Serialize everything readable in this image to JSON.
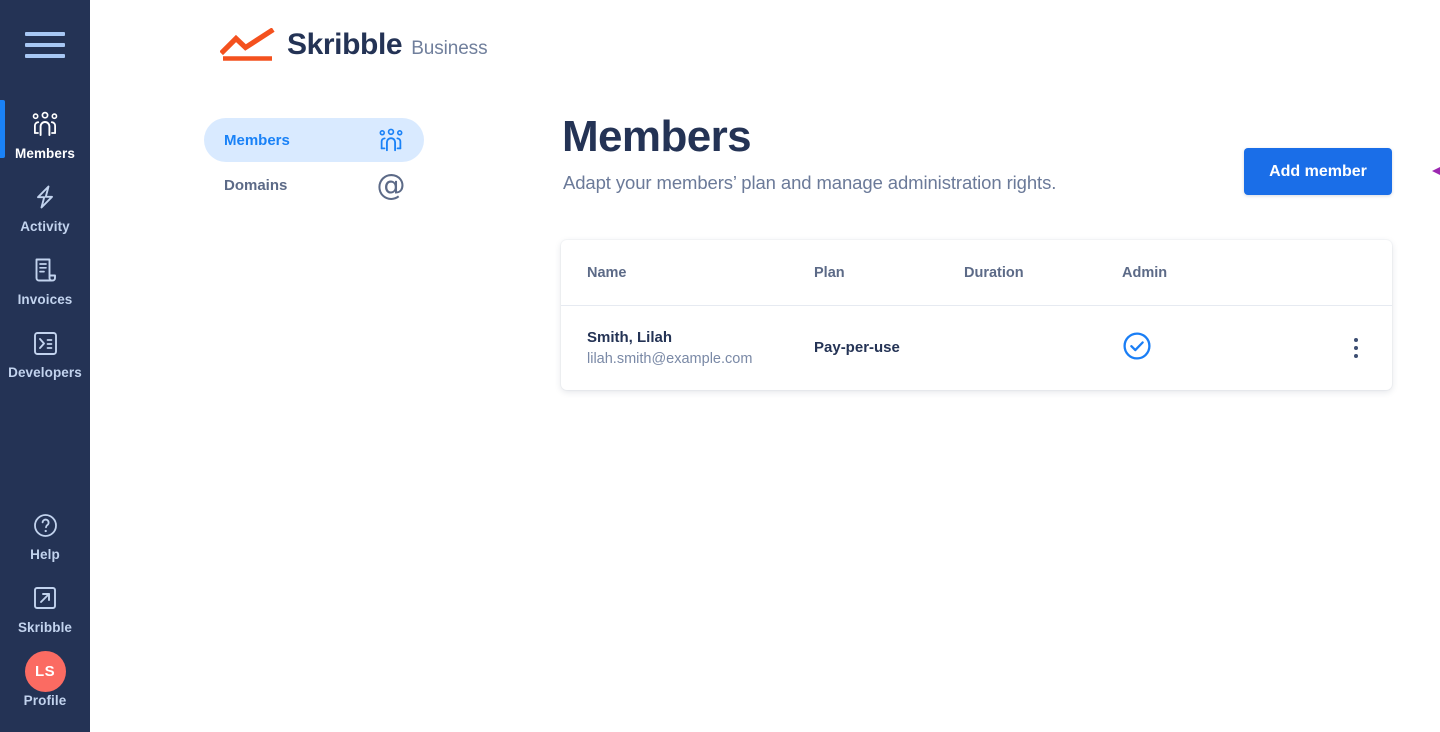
{
  "brand": {
    "logo_icon": "skribble-chart-logo",
    "name": "Skribble",
    "suffix": "Business"
  },
  "colors": {
    "sidebar_bg": "#243355",
    "accent_blue": "#1a82f7",
    "button_blue": "#1a6ee8",
    "logo_orange": "#f4511e",
    "avatar_coral": "#fb6b62",
    "annotation_purple": "#9c27b0",
    "heading_navy": "#243355",
    "tab_active_bg": "#d9eaff"
  },
  "sidebar": {
    "menu_toggle": "hamburger-menu",
    "top_items": [
      {
        "label": "Members",
        "icon": "members-group-icon",
        "active": true
      },
      {
        "label": "Activity",
        "icon": "lightning-bolt-icon",
        "active": false
      },
      {
        "label": "Invoices",
        "icon": "document-invoice-icon",
        "active": false
      },
      {
        "label": "Developers",
        "icon": "terminal-code-icon",
        "active": false
      }
    ],
    "bottom_items": [
      {
        "label": "Help",
        "icon": "question-circle-icon"
      },
      {
        "label": "Skribble",
        "icon": "external-link-icon"
      },
      {
        "label": "Profile",
        "icon": "avatar-initials",
        "initials": "LS"
      }
    ]
  },
  "tabs": [
    {
      "label": "Members",
      "icon": "members-group-icon",
      "active": true
    },
    {
      "label": "Domains",
      "icon": "at-sign-icon",
      "active": false
    }
  ],
  "header": {
    "title": "Members",
    "subtitle": "Adapt your members’ plan and manage administration rights.",
    "add_button": "Add member",
    "annotation": "left-pointing-arrow"
  },
  "table": {
    "columns": [
      "Name",
      "Plan",
      "Duration",
      "Admin"
    ],
    "rows": [
      {
        "name": "Smith, Lilah",
        "email": "lilah.smith@example.com",
        "plan": "Pay-per-use",
        "duration": "",
        "admin": true,
        "admin_icon": "check-circle-icon",
        "actions_icon": "kebab-menu-icon"
      }
    ]
  }
}
